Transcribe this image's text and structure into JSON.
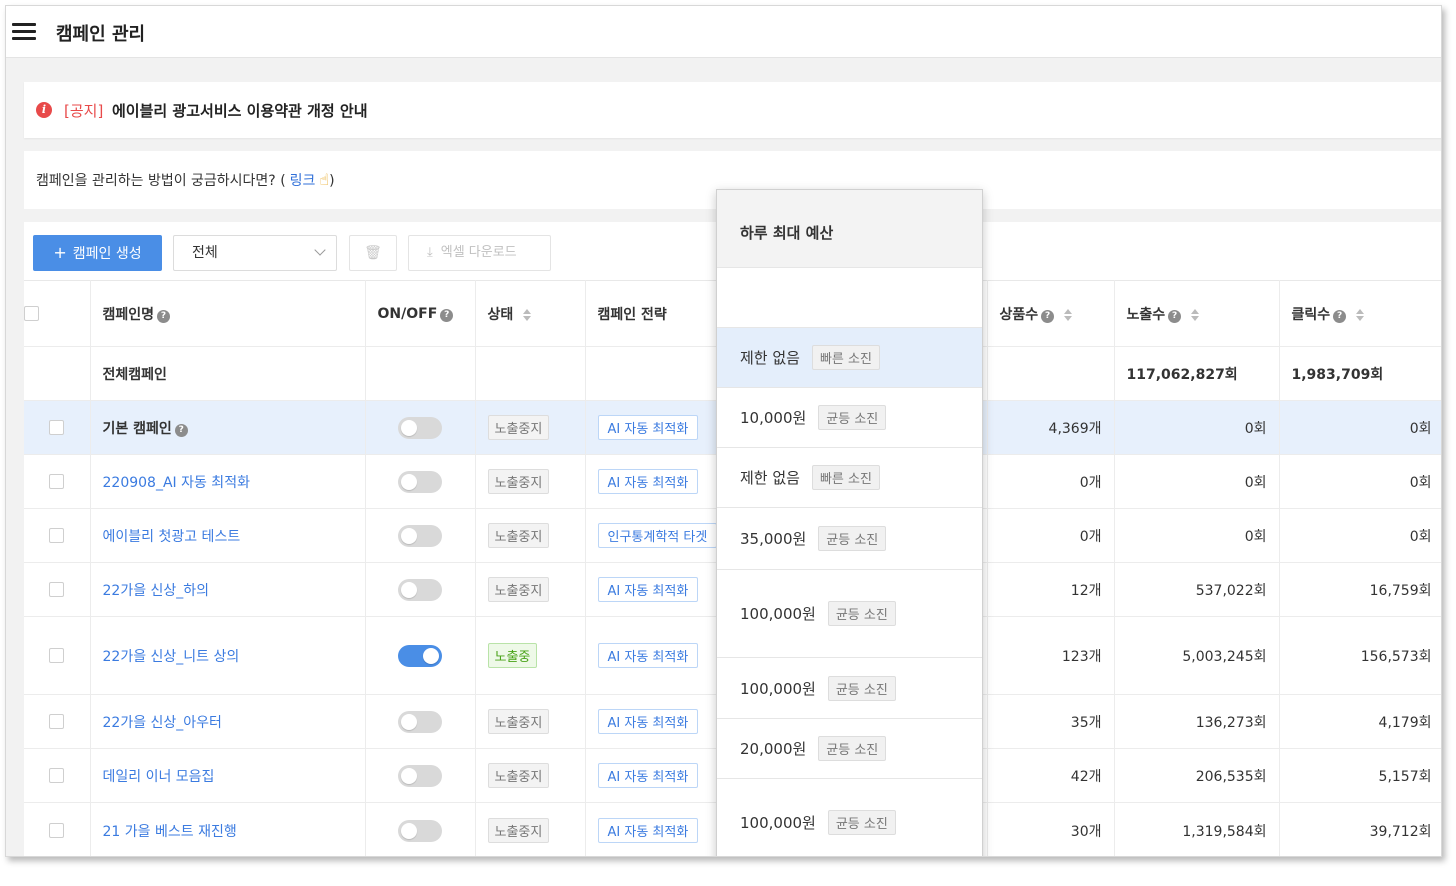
{
  "header": {
    "title": "캠페인 관리"
  },
  "notice": {
    "tag": "[공지]",
    "text": "에이블리 광고서비스 이용약관 개정 안내"
  },
  "help": {
    "text": "캠페인을 관리하는 방법이 궁금하시다면? (",
    "link": "링크",
    "close": ")"
  },
  "toolbar": {
    "create_label": "캠페인 생성",
    "filter_value": "전체",
    "excel_label": "엑셀 다운로드"
  },
  "columns": {
    "name": "캠페인명",
    "onoff": "ON/OFF",
    "status": "상태",
    "strategy": "캠페인 전략",
    "products": "상품수",
    "impressions": "노출수",
    "clicks": "클릭수"
  },
  "total_row": {
    "name": "전체캠페인",
    "impressions": "117,062,827회",
    "clicks": "1,983,709회"
  },
  "rows": [
    {
      "name": "기본 캠페인",
      "on": false,
      "status": "노출중지",
      "strategy": "AI 자동 최적화",
      "products": "4,369개",
      "impressions": "0회",
      "clicks": "0회"
    },
    {
      "name": "220908_AI 자동 최적화",
      "on": false,
      "status": "노출중지",
      "strategy": "AI 자동 최적화",
      "products": "0개",
      "impressions": "0회",
      "clicks": "0회"
    },
    {
      "name": "에이블리 첫광고 테스트",
      "on": false,
      "status": "노출중지",
      "strategy": "인구통계학적 타겟",
      "products": "0개",
      "impressions": "0회",
      "clicks": "0회"
    },
    {
      "name": "22가을 신상_하의",
      "on": false,
      "status": "노출중지",
      "strategy": "AI 자동 최적화",
      "products": "12개",
      "impressions": "537,022회",
      "clicks": "16,759회"
    },
    {
      "name": "22가을 신상_니트 상의",
      "on": true,
      "status": "노출중",
      "strategy": "AI 자동 최적화",
      "products": "123개",
      "impressions": "5,003,245회",
      "clicks": "156,573회"
    },
    {
      "name": "22가을 신상_아우터",
      "on": false,
      "status": "노출중지",
      "strategy": "AI 자동 최적화",
      "products": "35개",
      "impressions": "136,273회",
      "clicks": "4,179회"
    },
    {
      "name": "데일리 이너 모음집",
      "on": false,
      "status": "노출중지",
      "strategy": "AI 자동 최적화",
      "products": "42개",
      "impressions": "206,535회",
      "clicks": "5,157회"
    },
    {
      "name": "21 가을 베스트 재진행",
      "on": false,
      "status": "노출중지",
      "strategy": "AI 자동 최적화",
      "products": "30개",
      "impressions": "1,319,584회",
      "clicks": "39,712회"
    }
  ],
  "budget_popup": {
    "title": "하루 최대 예산",
    "options": [
      {
        "amount": "제한 없음",
        "mode": "빠른 소진"
      },
      {
        "amount": "10,000원",
        "mode": "균등 소진"
      },
      {
        "amount": "제한 없음",
        "mode": "빠른 소진"
      },
      {
        "amount": "35,000원",
        "mode": "균등 소진"
      },
      {
        "amount": "100,000원",
        "mode": "균등 소진"
      },
      {
        "amount": "100,000원",
        "mode": "균등 소진"
      },
      {
        "amount": "20,000원",
        "mode": "균등 소진"
      },
      {
        "amount": "100,000원",
        "mode": "균등 소진"
      }
    ]
  },
  "colors": {
    "accent": "#4a8ee6",
    "link": "#3b7be0",
    "notice_red": "#e84a4a",
    "on_green": "#49a318",
    "row_highlight": "#e7f0fc"
  },
  "icons": [
    "menu-icon",
    "info-icon",
    "hand-pointer-icon",
    "plus-icon",
    "chevron-down-icon",
    "trash-icon",
    "download-icon",
    "help-icon",
    "sort-icon"
  ]
}
